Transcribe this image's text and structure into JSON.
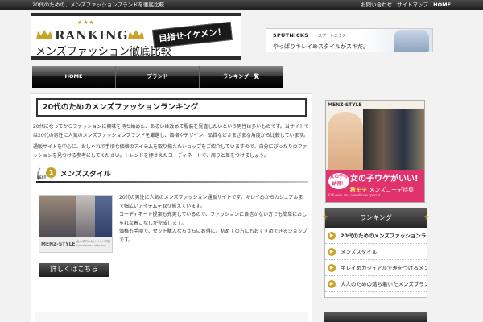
{
  "topbar": {
    "tagline": "20代のための、メンズファッションブランドを徹底比較",
    "link1": "お問い合わせ",
    "link2": "サイトマップ",
    "home": "HOME"
  },
  "logo": {
    "stars": "★★★",
    "ranking": "RANKING",
    "subtitle": "メンズファッション徹底比較",
    "badge": "目指せイケメン！"
  },
  "top_ad": {
    "brand": "SPUTNICKS",
    "brand_sub": "スプートニクス",
    "copy": "やっぱりキレイめスタイルがスキだ。"
  },
  "nav": {
    "items": [
      "HOME",
      "ブランド",
      "ランキング一覧"
    ]
  },
  "main": {
    "title": "20代のためのメンズファッションランキング",
    "para1": "20代になってからファッションに興味を持ち始めた、あるいは改めて服装を見直したいという男性は多いものです。当サイトでは20代の男性に人気のメンズファッションブランドを厳選し、価格やデザイン、品質などさまざまな角度から比較しています。",
    "para2": "通販サイトを中心に、おしゃれで手頃な価格のアイテムを取り揃えたショップをご紹介していますので、自分にぴったりのファッションを見つける参考にしてください。トレンドを押さえたコーディネートで、周りと差をつけましょう。",
    "section1": {
      "best_label": "BEST",
      "rank": "1",
      "title": "メンズスタイル",
      "product_label": "MENZ-STYLE",
      "product_caption": "女の子ウケがいいメンズ服 coordinate collection",
      "desc1": "20代の男性に人気のメンズファッション通販サイトです。キレイめからカジュアルまで幅広いアイテムを取り揃えています。",
      "desc2": "コーディネート提案も充実しているので、ファッションに自信がない方でも簡単におしゃれな着こなしが完成します。",
      "desc3": "価格も手頃で、セット購入ならさらにお得に。初めての方にもおすすめできるショップです。",
      "button": "詳しくはこちら"
    }
  },
  "side_ad": {
    "header": "MENZ-STYLE",
    "badge": "女の子も納得！",
    "big": "女の子ウケがいい!",
    "small_lead": "秋モテ",
    "small_rest": "メンズコーデ特集",
    "tiny": "Fall men and coordinate special"
  },
  "sidebar": {
    "heading": "ランキング",
    "items": [
      "20代のためのメンズファッションランキング",
      "メンズスタイル",
      "キレイめカジュアルで差をつけるメンズファッション通販",
      "大人のための落ち着いたメンズブランド"
    ]
  },
  "colors": {
    "accent_gold": "#c9a227",
    "ad_pink": "#e0326c",
    "nav_dark": "#111111"
  }
}
